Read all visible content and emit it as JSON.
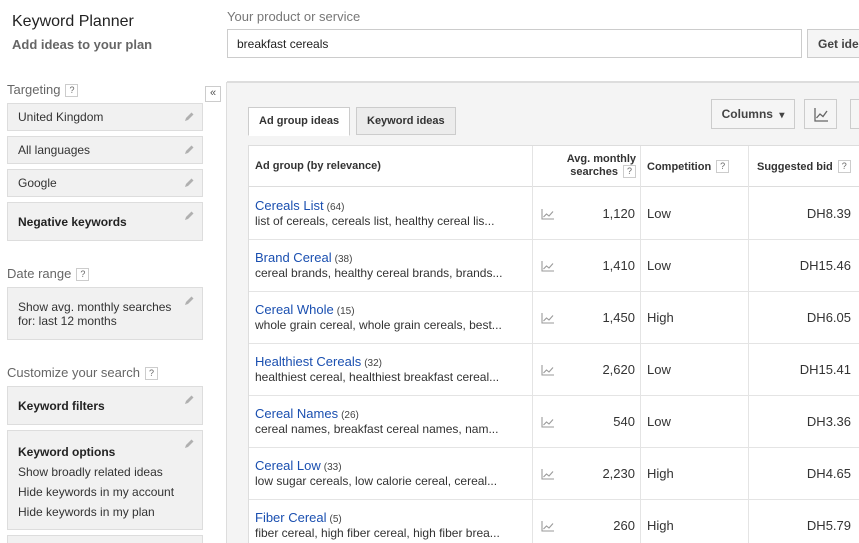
{
  "header": {
    "app_title": "Keyword Planner",
    "app_subtitle": "Add ideas to your plan",
    "product_label": "Your product or service",
    "search_value": "breakfast cereals",
    "get_ideas_label": "Get ideas"
  },
  "sidebar": {
    "collapse_label": "«",
    "targeting_label": "Targeting",
    "targeting_items": [
      "United Kingdom",
      "All languages",
      "Google"
    ],
    "negative_keywords_label": "Negative keywords",
    "date_range_label": "Date range",
    "date_range_line1": "Show avg. monthly searches",
    "date_range_line2": "for: last 12 months",
    "customize_label": "Customize your search",
    "keyword_filters_label": "Keyword filters",
    "keyword_options_label": "Keyword options",
    "keyword_options_items": [
      "Show broadly related ideas",
      "Hide keywords in my account",
      "Hide keywords in my plan"
    ],
    "help_mark": "?"
  },
  "main": {
    "tabs": [
      "Ad group ideas",
      "Keyword ideas"
    ],
    "columns_label": "Columns",
    "columns_caret": "▾",
    "table": {
      "headers": {
        "ad_group": "Ad group (by relevance)",
        "searches_line1": "Avg. monthly",
        "searches_line2": "searches",
        "competition": "Competition",
        "suggested_bid": "Suggested bid"
      },
      "rows": [
        {
          "name": "Cereals List",
          "count": "(64)",
          "keywords": "list of cereals, cereals list, healthy cereal lis...",
          "searches": "1,120",
          "competition": "Low",
          "bid": "DH8.39"
        },
        {
          "name": "Brand Cereal",
          "count": "(38)",
          "keywords": "cereal brands, healthy cereal brands, brands...",
          "searches": "1,410",
          "competition": "Low",
          "bid": "DH15.46"
        },
        {
          "name": "Cereal Whole",
          "count": "(15)",
          "keywords": "whole grain cereal, whole grain cereals, best...",
          "searches": "1,450",
          "competition": "High",
          "bid": "DH6.05"
        },
        {
          "name": "Healthiest Cereals",
          "count": "(32)",
          "keywords": "healthiest cereal, healthiest breakfast cereal...",
          "searches": "2,620",
          "competition": "Low",
          "bid": "DH15.41"
        },
        {
          "name": "Cereal Names",
          "count": "(26)",
          "keywords": "cereal names, breakfast cereal names, nam...",
          "searches": "540",
          "competition": "Low",
          "bid": "DH3.36"
        },
        {
          "name": "Cereal Low",
          "count": "(33)",
          "keywords": "low sugar cereals, low calorie cereal, cereal...",
          "searches": "2,230",
          "competition": "High",
          "bid": "DH4.65"
        },
        {
          "name": "Fiber Cereal",
          "count": "(5)",
          "keywords": "fiber cereal, high fiber cereal, high fiber brea...",
          "searches": "260",
          "competition": "High",
          "bid": "DH5.79"
        }
      ]
    }
  },
  "colors": {
    "link": "#1a4fb0",
    "panel_bg": "#f1f1f1",
    "border": "#dddddd"
  }
}
